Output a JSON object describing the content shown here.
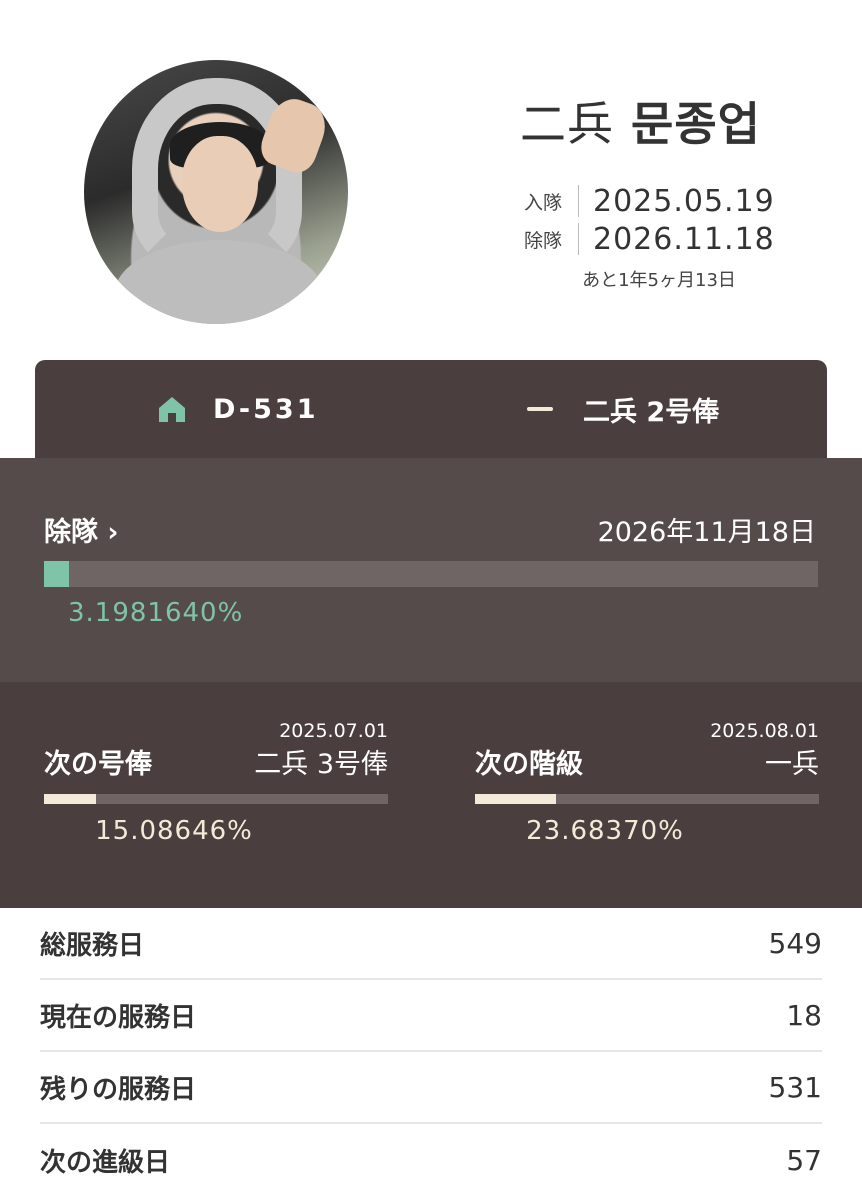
{
  "profile": {
    "rank": "二兵",
    "name": "문종업",
    "enlist_label": "入隊",
    "enlist_date": "2025.05.19",
    "discharge_label": "除隊",
    "discharge_date": "2026.11.18",
    "remaining": "あと1年5ヶ月13日"
  },
  "tabs": [
    {
      "label": "D-531",
      "icon": "home-icon"
    },
    {
      "label": "二兵 2号俸",
      "icon": "dash-icon"
    }
  ],
  "discharge": {
    "label": "除隊 ›",
    "date": "2026年11月18日",
    "percent": "3.1981640%",
    "progress": 0.03198,
    "color": "#7fc3a8"
  },
  "next": [
    {
      "label": "次の号俸",
      "date": "2025.07.01",
      "value": "二兵 3号俸",
      "percent": "15.08646%",
      "progress": 0.1509
    },
    {
      "label": "次の階級",
      "date": "2025.08.01",
      "value": "一兵",
      "percent": "23.68370%",
      "progress": 0.2368
    }
  ],
  "stats": [
    {
      "label": "総服務日",
      "value": "549"
    },
    {
      "label": "現在の服務日",
      "value": "18"
    },
    {
      "label": "残りの服務日",
      "value": "531"
    },
    {
      "label": "次の進級日",
      "value": "57"
    }
  ],
  "colors": {
    "dark_panel": "#4a3e3e",
    "mid_panel": "#564b4b",
    "accent_green": "#7fc3a8",
    "accent_cream": "#f4ead7"
  }
}
